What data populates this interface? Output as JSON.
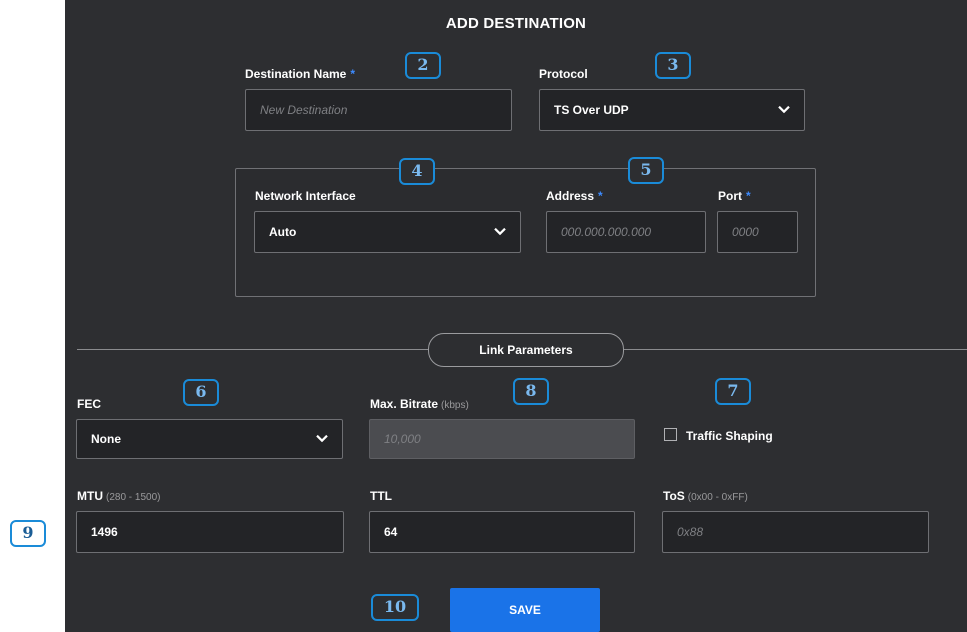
{
  "title": "ADD DESTINATION",
  "destination": {
    "label": "Destination Name",
    "required_mark": "*",
    "placeholder": "New Destination"
  },
  "protocol": {
    "label": "Protocol",
    "value": "TS Over UDP"
  },
  "network_interface": {
    "label": "Network Interface",
    "value": "Auto"
  },
  "address": {
    "label": "Address",
    "required_mark": "*",
    "placeholder": "000.000.000.000"
  },
  "port": {
    "label": "Port",
    "required_mark": "*",
    "placeholder": "0000"
  },
  "link_parameters": {
    "label": "Link Parameters"
  },
  "fec": {
    "label": "FEC",
    "value": "None"
  },
  "max_bitrate": {
    "label": "Max. Bitrate",
    "hint": "(kbps)",
    "placeholder": "10,000"
  },
  "traffic_shaping": {
    "label": "Traffic Shaping",
    "checked": false
  },
  "mtu": {
    "label": "MTU",
    "hint": "(280 - 1500)",
    "value": "1496"
  },
  "ttl": {
    "label": "TTL",
    "value": "64"
  },
  "tos": {
    "label": "ToS",
    "hint": "(0x00 - 0xFF)",
    "placeholder": "0x88"
  },
  "save": {
    "label": "SAVE"
  },
  "callouts": {
    "c2": "2",
    "c3": "3",
    "c4": "4",
    "c5": "5",
    "c6": "6",
    "c7": "7",
    "c8": "8",
    "c9": "9",
    "c10": "10"
  },
  "colors": {
    "panel": "#2d2e31",
    "accent": "#1a73e8",
    "required": "#3d8bff",
    "callout_border": "#1a8bd8"
  },
  "icons": {
    "chevron": "chevron-down-icon",
    "checkbox": "checkbox-icon"
  }
}
